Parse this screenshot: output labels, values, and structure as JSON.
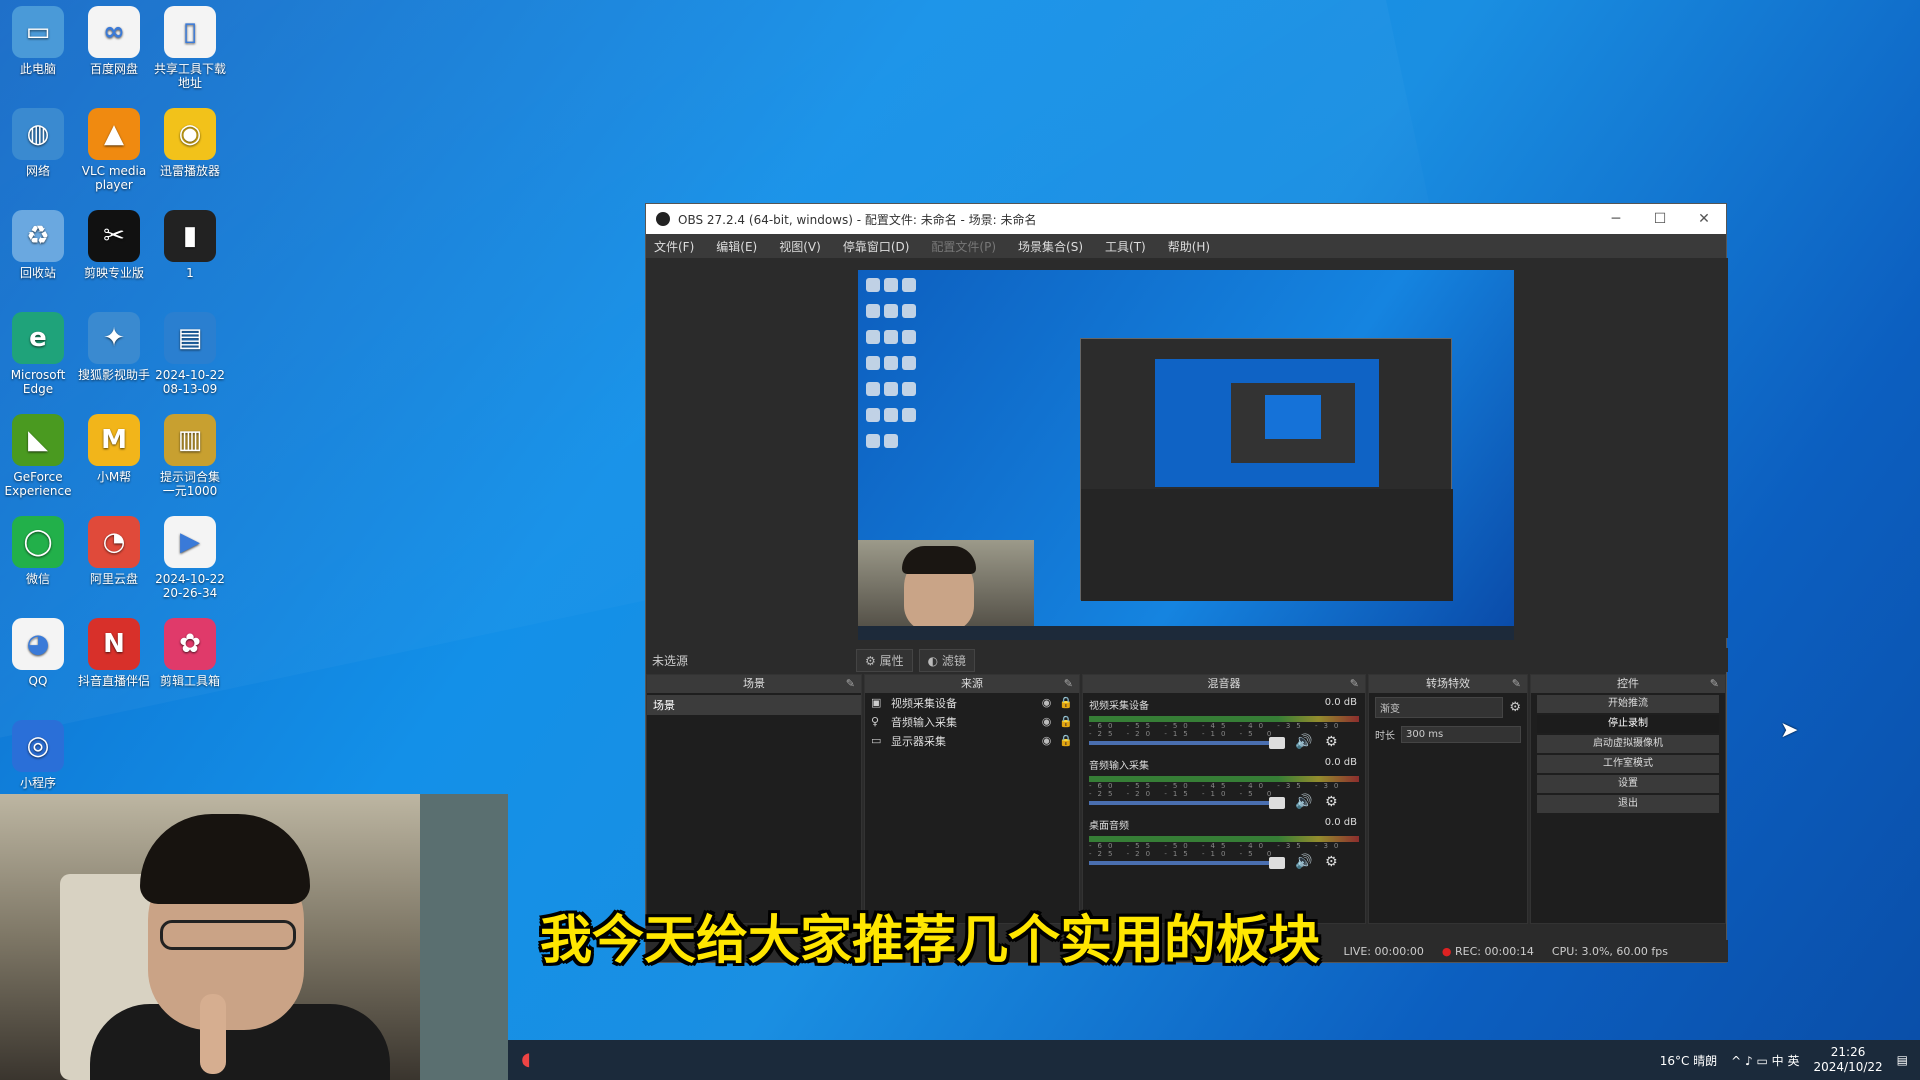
{
  "desktop": {
    "icons": [
      {
        "label": "此电脑",
        "glyph": "▭",
        "color": "#4a9ad8"
      },
      {
        "label": "百度网盘",
        "glyph": "∞",
        "color": "#ffffff"
      },
      {
        "label": "共享工具下载地址",
        "glyph": "▯",
        "color": "#eeeeee"
      },
      {
        "label": "网络",
        "glyph": "◍",
        "color": "#3a8ad0"
      },
      {
        "label": "VLC media player",
        "glyph": "▲",
        "color": "#f08a10"
      },
      {
        "label": "迅雷播放器",
        "glyph": "◉",
        "color": "#f2c21a"
      },
      {
        "label": "回收站",
        "glyph": "♻",
        "color": "#6aa8e0"
      },
      {
        "label": "剪映专业版",
        "glyph": "✂",
        "color": "#111111"
      },
      {
        "label": "1",
        "glyph": "▮",
        "color": "#222222"
      },
      {
        "label": "Microsoft Edge",
        "glyph": "e",
        "color": "#1fa37a"
      },
      {
        "label": "搜狐影视助手",
        "glyph": "✦",
        "color": "#3a8ad0"
      },
      {
        "label": "2024-10-22 08-13-09",
        "glyph": "▤",
        "color": "#2a7fd0"
      },
      {
        "label": "GeForce Experience",
        "glyph": "◣",
        "color": "#4a9a20"
      },
      {
        "label": "小M帮",
        "glyph": "M",
        "color": "#f2b51a"
      },
      {
        "label": "提示词合集 一元1000",
        "glyph": "▥",
        "color": "#c8a030"
      },
      {
        "label": "微信",
        "glyph": "◯",
        "color": "#22b04a"
      },
      {
        "label": "阿里云盘",
        "glyph": "◔",
        "color": "#e04a3a"
      },
      {
        "label": "2024-10-22 20-26-34",
        "glyph": "▶",
        "color": "#ffffff"
      },
      {
        "label": "QQ",
        "glyph": "◕",
        "color": "#ffffff"
      },
      {
        "label": "抖音直播伴侣",
        "glyph": "N",
        "color": "#d8302a"
      },
      {
        "label": "剪辑工具箱",
        "glyph": "✿",
        "color": "#e03a6a"
      },
      {
        "label": "小程序",
        "glyph": "◎",
        "color": "#2a6fd8"
      }
    ]
  },
  "obs": {
    "title": "OBS 27.2.4 (64-bit, windows) - 配置文件: 未命名 - 场景: 未命名",
    "menu": [
      "文件(F)",
      "编辑(E)",
      "视图(V)",
      "停靠窗口(D)",
      "配置文件(P)",
      "场景集合(S)",
      "工具(T)",
      "帮助(H)"
    ],
    "disabled_menu_index": 4,
    "window_controls": {
      "minimize": "─",
      "maximize": "☐",
      "close": "✕"
    },
    "toolbar": {
      "label": "未选源",
      "properties": "属性",
      "filters": "滤镜"
    },
    "docks": {
      "scenes": {
        "title": "场景",
        "items": [
          "场景"
        ]
      },
      "sources": {
        "title": "来源",
        "items": [
          {
            "icon": "▣",
            "label": "视频采集设备"
          },
          {
            "icon": "♀",
            "label": "音频输入采集"
          },
          {
            "icon": "▭",
            "label": "显示器采集"
          }
        ]
      },
      "mixer": {
        "title": "混音器",
        "channels": [
          {
            "name": "视频采集设备",
            "db": "0.0 dB"
          },
          {
            "name": "音频输入采集",
            "db": "0.0 dB"
          },
          {
            "name": "桌面音频",
            "db": "0.0 dB"
          }
        ],
        "scale": "-60 -55 -50 -45 -40 -35 -30 -25 -20 -15 -10 -5 0"
      },
      "transitions": {
        "title": "转场特效",
        "type": "渐变",
        "duration_label": "时长",
        "duration": "300 ms"
      },
      "controls": {
        "title": "控件",
        "buttons": [
          "开始推流",
          "停止录制",
          "启动虚拟摄像机",
          "工作室模式",
          "设置",
          "退出"
        ],
        "active_index": 1
      }
    },
    "statusbar": {
      "live": "LIVE: 00:00:00",
      "rec": "REC: 00:00:14",
      "cpu": "CPU: 3.0%, 60.00 fps"
    }
  },
  "taskbar": {
    "weather": "16°C 晴朗",
    "tray": "^ ♪ ▭ 中 英",
    "time": "21:26",
    "date": "2024/10/22"
  },
  "subtitle": "我今天给大家推荐几个实用的板块",
  "colors": {
    "subtitle": "#ffe600",
    "desktop": "#1390e8",
    "obs_bg": "#2b2b2b"
  }
}
